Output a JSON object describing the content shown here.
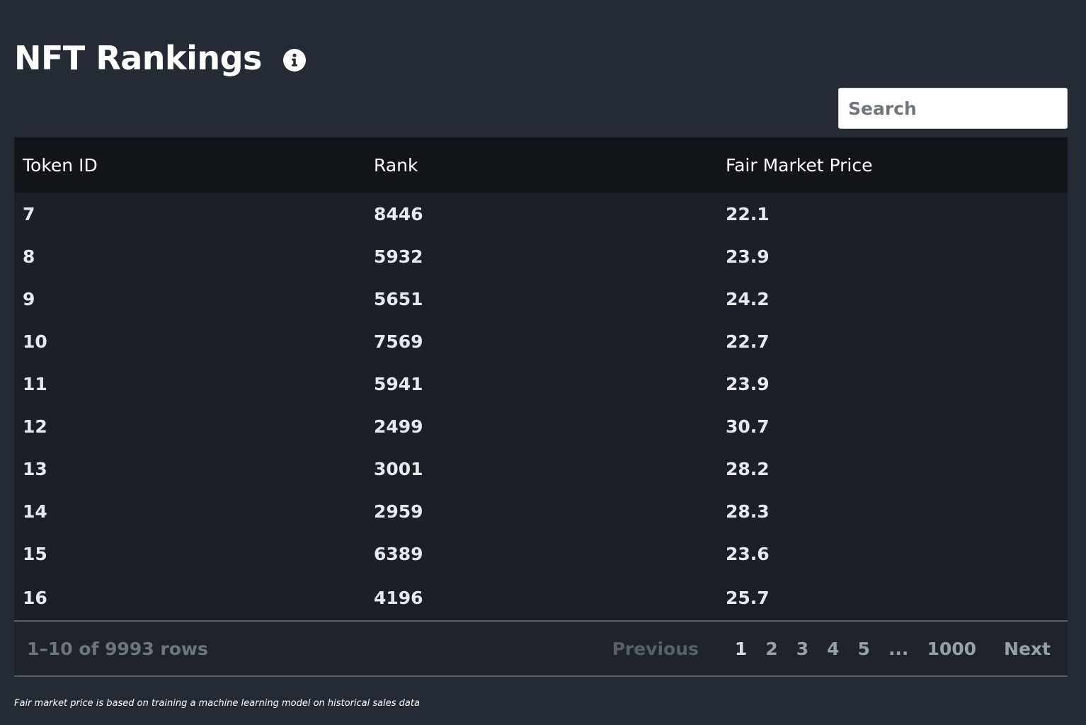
{
  "header": {
    "title": "NFT Rankings"
  },
  "search": {
    "placeholder": "Search"
  },
  "table": {
    "columns": [
      "Token ID",
      "Rank",
      "Fair Market Price"
    ],
    "rows": [
      [
        "7",
        "8446",
        "22.1"
      ],
      [
        "8",
        "5932",
        "23.9"
      ],
      [
        "9",
        "5651",
        "24.2"
      ],
      [
        "10",
        "7569",
        "22.7"
      ],
      [
        "11",
        "5941",
        "23.9"
      ],
      [
        "12",
        "2499",
        "30.7"
      ],
      [
        "13",
        "3001",
        "28.2"
      ],
      [
        "14",
        "2959",
        "28.3"
      ],
      [
        "15",
        "6389",
        "23.6"
      ],
      [
        "16",
        "4196",
        "25.7"
      ]
    ]
  },
  "pagination": {
    "summary": "1–10 of 9993 rows",
    "previous": "Previous",
    "pages": [
      "1",
      "2",
      "3",
      "4",
      "5"
    ],
    "ellipsis": "...",
    "last_page": "1000",
    "next": "Next"
  },
  "footnote": "Fair market price is based on training a machine learning model on historical sales data"
}
